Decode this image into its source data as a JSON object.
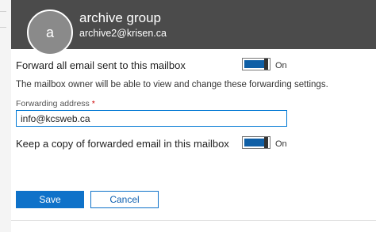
{
  "header": {
    "avatar_initial": "a",
    "name": "archive group",
    "email": "archive2@krisen.ca"
  },
  "forwarding": {
    "label": "Forward all email sent to this mailbox",
    "toggle_state": "On",
    "description": "The mailbox owner will be able to view and change these forwarding settings.",
    "address_label": "Forwarding address",
    "address_required_mark": "*",
    "address_value": "info@kcsweb.ca"
  },
  "keep_copy": {
    "label": "Keep a copy of forwarded email in this mailbox",
    "toggle_state": "On"
  },
  "actions": {
    "save_label": "Save",
    "cancel_label": "Cancel"
  },
  "colors": {
    "header_bg": "#4b4b4b",
    "accent": "#0f72c9",
    "toggle_on": "#0f5fa6"
  }
}
